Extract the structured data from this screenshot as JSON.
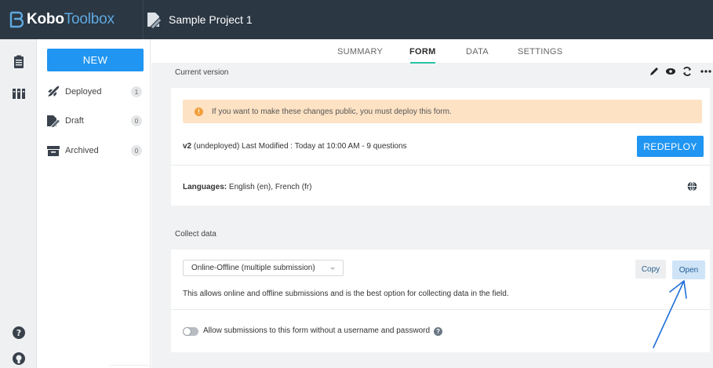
{
  "topbar": {
    "logo_bold": "Kobo",
    "logo_light": "Toolbox",
    "project_title": "Sample Project 1"
  },
  "sidebar": {
    "new_label": "NEW",
    "items": [
      {
        "label": "Deployed",
        "count": "1",
        "icon": "rocket-icon"
      },
      {
        "label": "Draft",
        "count": "0",
        "icon": "draft-icon"
      },
      {
        "label": "Archived",
        "count": "0",
        "icon": "archive-icon"
      }
    ]
  },
  "rail": {
    "icons": [
      "forms-icon",
      "library-icon",
      "help-icon",
      "github-icon"
    ]
  },
  "tabs": [
    {
      "label": "SUMMARY"
    },
    {
      "label": "FORM",
      "active": true
    },
    {
      "label": "DATA"
    },
    {
      "label": "SETTINGS"
    }
  ],
  "current_version": {
    "label": "Current version",
    "alert": "If you want to make these changes public, you must deploy this form.",
    "version_bold": "v2",
    "version_rest": " (undeployed)  Last Modified : Today at 10:00 AM - 9 questions",
    "redeploy_label": "REDEPLOY",
    "languages_label": "Languages:",
    "languages_value": " English (en), French (fr)"
  },
  "collect": {
    "label": "Collect data",
    "select_value": "Online-Offline (multiple submission)",
    "description": "This allows online and offline submissions and is the best option for collecting data in the field.",
    "copy_label": "Copy",
    "open_label": "Open",
    "anon_label": "Allow submissions to this form without a username and password"
  },
  "colors": {
    "topbar": "#2b3743",
    "accent": "#2095f2",
    "tab_underline": "#2ac2a6",
    "alert_bg": "#fde2c4",
    "annotation_arrow": "#1e6fd9"
  }
}
